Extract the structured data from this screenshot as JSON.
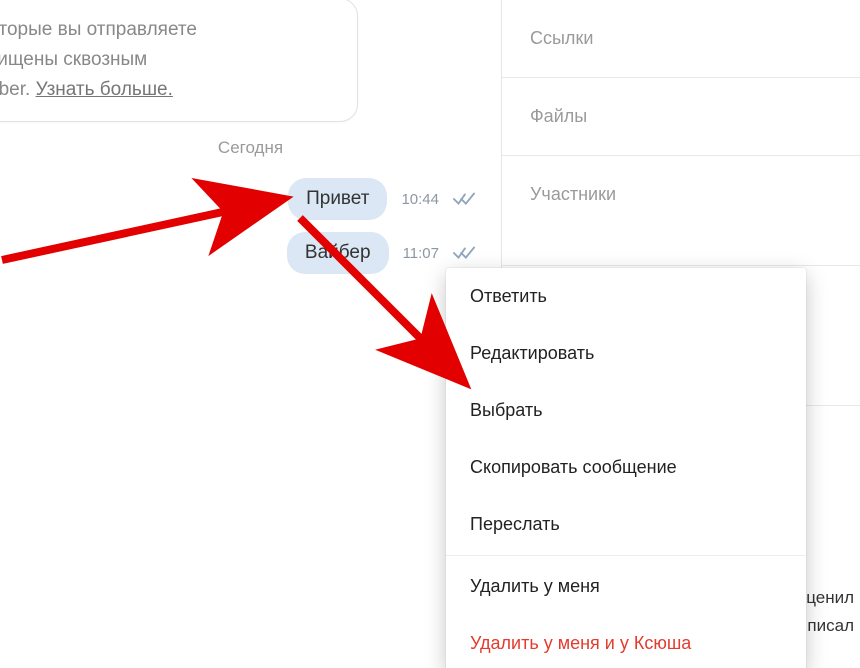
{
  "encryption": {
    "line1": "бщения, которые вы отправляете",
    "line2": "от чат, защищены сквозным",
    "line3_prefix": "ованием Viber. ",
    "learn_more": "Узнать больше."
  },
  "date_separator": "Сегодня",
  "messages": [
    {
      "text": "Привет",
      "time": "10:44"
    },
    {
      "text": "Вайбер",
      "time": "11:07"
    }
  ],
  "sidebar": {
    "links": "Ссылки",
    "files": "Файлы",
    "participants": "Участники",
    "partial_line1": "о оценил",
    "partial_line2": "писал"
  },
  "context_menu": {
    "reply": "Ответить",
    "edit": "Редактировать",
    "select": "Выбрать",
    "copy": "Скопировать сообщение",
    "forward": "Переслать",
    "delete_me": "Удалить у меня",
    "delete_all": "Удалить у меня и у Ксюша"
  }
}
